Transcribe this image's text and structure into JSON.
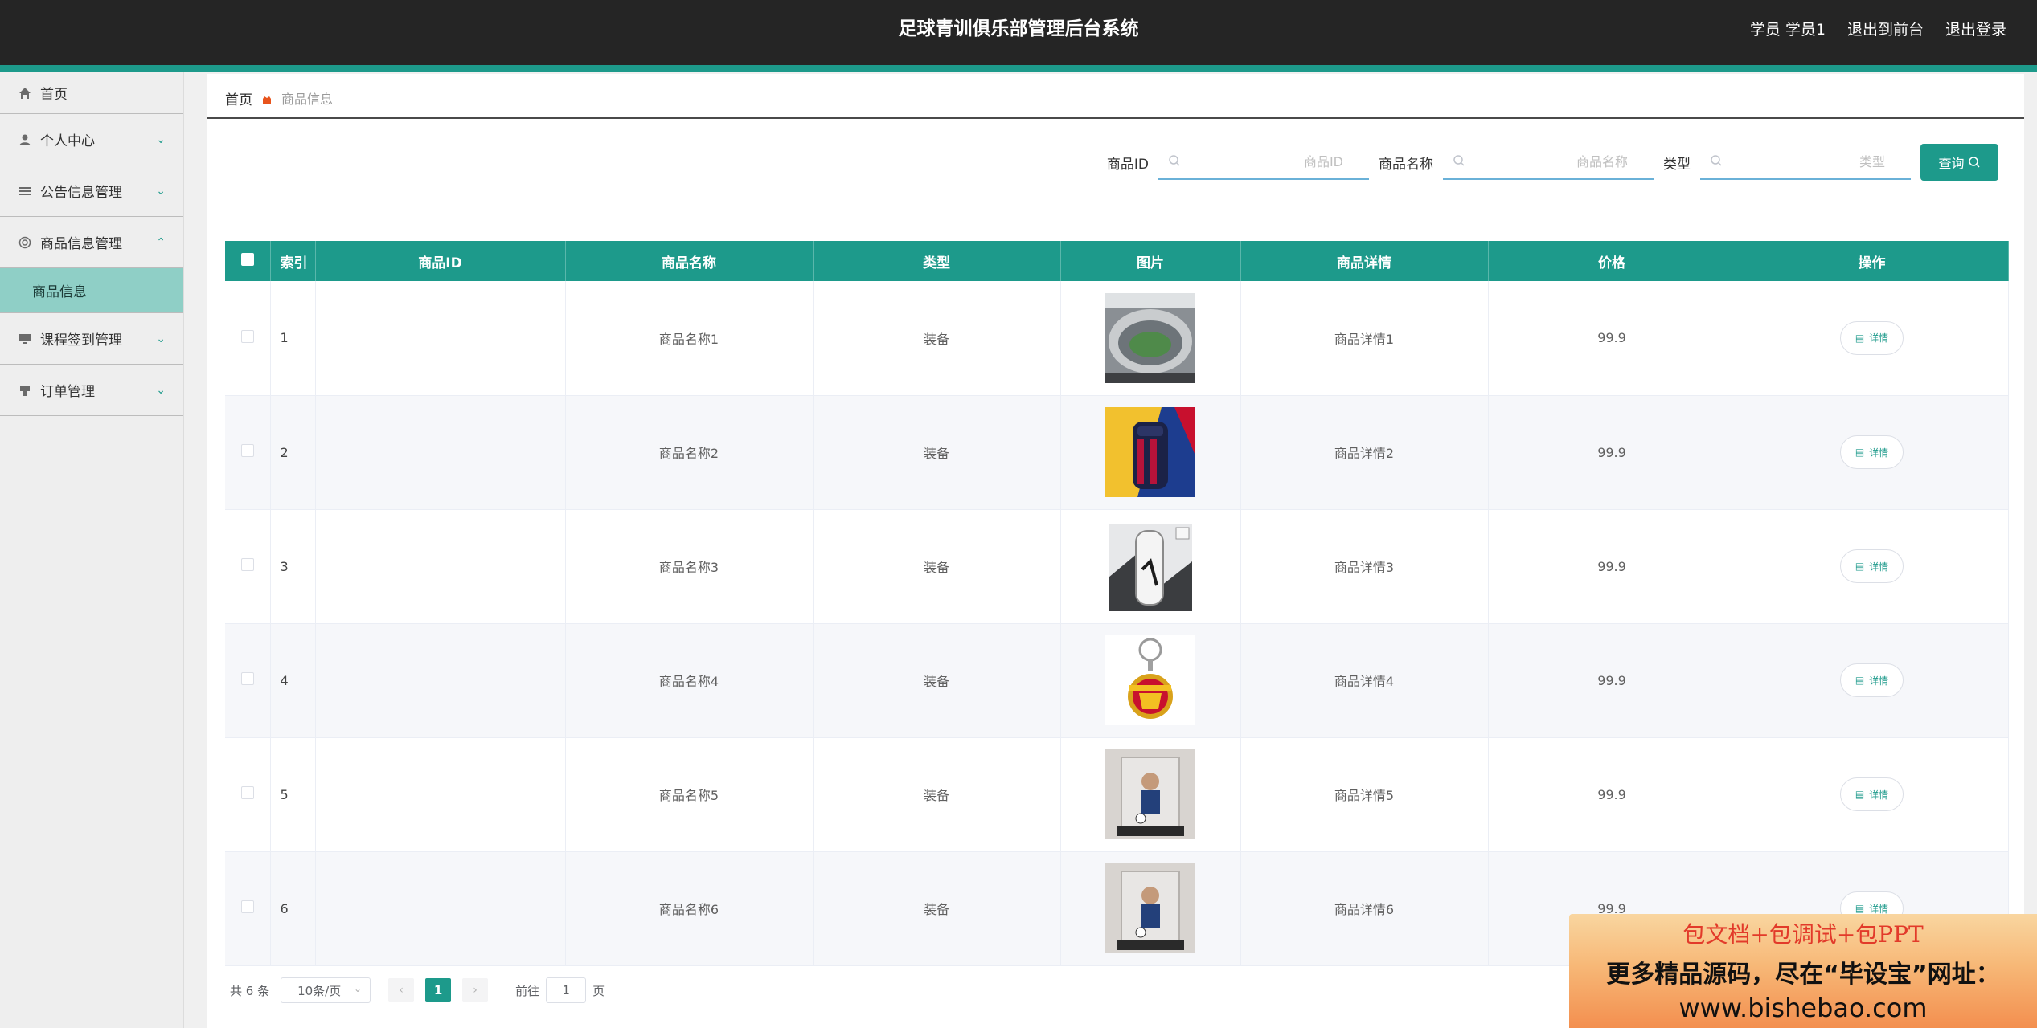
{
  "header": {
    "title": "足球青训俱乐部管理后台系统",
    "user": "学员 学员1",
    "to_front": "退出到前台",
    "logout": "退出登录"
  },
  "sidebar": {
    "items": [
      {
        "label": "首页",
        "icon": "home-icon"
      },
      {
        "label": "个人中心",
        "icon": "user-icon"
      },
      {
        "label": "公告信息管理",
        "icon": "list-icon"
      },
      {
        "label": "商品信息管理",
        "icon": "goods-icon"
      },
      {
        "label": "商品信息",
        "icon": ""
      },
      {
        "label": "课程签到管理",
        "icon": "monitor-icon"
      },
      {
        "label": "订单管理",
        "icon": "order-icon"
      }
    ]
  },
  "breadcrumb": {
    "home": "首页",
    "current": "商品信息"
  },
  "search": {
    "id_label": "商品ID",
    "id_placeholder": "商品ID",
    "name_label": "商品名称",
    "name_placeholder": "商品名称",
    "type_label": "类型",
    "type_placeholder": "类型",
    "button": "查询"
  },
  "table": {
    "columns": [
      "索引",
      "商品ID",
      "商品名称",
      "类型",
      "图片",
      "商品详情",
      "价格",
      "操作"
    ],
    "detail_label": "详情",
    "rows": [
      {
        "index": "1",
        "id": "",
        "name": "商品名称1",
        "type": "装备",
        "image": "stadium",
        "detail": "商品详情1",
        "price": "99.9"
      },
      {
        "index": "2",
        "id": "",
        "name": "商品名称2",
        "type": "装备",
        "image": "backpack",
        "detail": "商品详情2",
        "price": "99.9"
      },
      {
        "index": "3",
        "id": "",
        "name": "商品名称3",
        "type": "装备",
        "image": "bottle",
        "detail": "商品详情3",
        "price": "99.9"
      },
      {
        "index": "4",
        "id": "",
        "name": "商品名称4",
        "type": "装备",
        "image": "keychain",
        "detail": "商品详情4",
        "price": "99.9"
      },
      {
        "index": "5",
        "id": "",
        "name": "商品名称5",
        "type": "装备",
        "image": "figure",
        "detail": "商品详情5",
        "price": "99.9"
      },
      {
        "index": "6",
        "id": "",
        "name": "商品名称6",
        "type": "装备",
        "image": "figure",
        "detail": "商品详情6",
        "price": "99.9"
      }
    ]
  },
  "pagination": {
    "total": "共 6 条",
    "page_size": "10条/页",
    "current_page": "1",
    "goto_label": "前往",
    "goto_value": "1",
    "page_unit": "页"
  },
  "ad": {
    "line1": "包文档+包调试+包PPT",
    "line2": "更多精品源码，尽在“毕设宝”网址：",
    "line3": "www.bishebao.com"
  },
  "colors": {
    "accent": "#1d9a8b",
    "header_bg": "#252525",
    "submenu_active": "#8fcfc6"
  }
}
